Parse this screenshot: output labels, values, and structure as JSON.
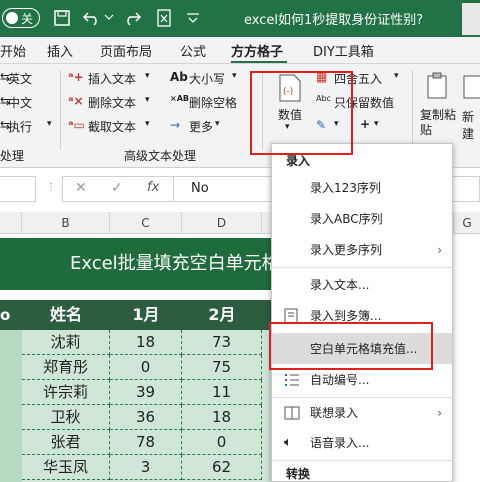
{
  "title": "excel如何1秒提取身份证性别?",
  "autosave": "关",
  "tabs": [
    "开始",
    "插入",
    "页面布局",
    "公式",
    "方方格子",
    "DIY工具箱"
  ],
  "active_tab": "方方格子",
  "ribbon": {
    "left_items": [
      "英文",
      "中文",
      "执行"
    ],
    "left_group": "处理",
    "insert_text": "插入文本",
    "delete_text": "删除文本",
    "cut_text": "截取文本",
    "case": "大小写",
    "delete_space": "删除空格",
    "more": "更多",
    "group_label": "高级文本处理",
    "numeric": "数值",
    "round": "四舍五入",
    "keep_num": "只保留数值",
    "copy_paste": "复制粘贴",
    "new_label": "新建",
    "plus": "+"
  },
  "formula": {
    "value": "No",
    "fx": "fx"
  },
  "columns": [
    "B",
    "C",
    "D",
    "G"
  ],
  "sheet": {
    "banner": "Excel批量填充空白单元格",
    "headers": [
      "o",
      "姓名",
      "1月",
      "2月"
    ],
    "rows": [
      [
        "沈莉",
        "18",
        "73"
      ],
      [
        "郑育彤",
        "0",
        "75"
      ],
      [
        "许宗莉",
        "39",
        "11"
      ],
      [
        "卫秋",
        "36",
        "18"
      ],
      [
        "张君",
        "78",
        "0"
      ],
      [
        "华玉凤",
        "3",
        "62"
      ]
    ]
  },
  "menu": {
    "section1": "录入",
    "items": [
      {
        "label": "录入123序列",
        "arrow": false
      },
      {
        "label": "录入ABC序列",
        "arrow": false
      },
      {
        "label": "录入更多序列",
        "arrow": true
      },
      {
        "label": "录入文本...",
        "arrow": false
      },
      {
        "label": "录入到多簿...",
        "arrow": false
      },
      {
        "label": "空白单元格填充值...",
        "arrow": false
      },
      {
        "label": "自动编号...",
        "arrow": false
      },
      {
        "label": "联想录入",
        "arrow": true
      },
      {
        "label": "语音录入...",
        "arrow": false
      }
    ],
    "section2": "转换"
  }
}
